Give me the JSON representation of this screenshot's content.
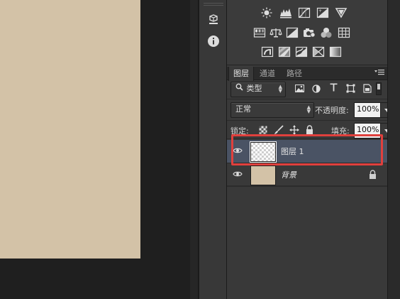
{
  "colors": {
    "canvas": "#d3c2a7",
    "selected_row": "#4a5364",
    "highlight_box": "#e0403d"
  },
  "tool_strip": {
    "items": [
      {
        "icon": "3d-object-icon"
      },
      {
        "icon": "info-icon"
      }
    ]
  },
  "adjustments": {
    "rows": [
      [
        "brightness-contrast-icon",
        "levels-icon",
        "curves-icon",
        "exposure-icon",
        "vibrance-icon"
      ],
      [
        "hue-saturation-icon",
        "color-balance-icon",
        "black-white-icon",
        "photo-filter-icon",
        "channel-mixer-icon",
        "color-lookup-icon"
      ],
      [
        "invert-icon",
        "posterize-icon",
        "threshold-icon",
        "selective-color-icon",
        "gradient-map-icon"
      ]
    ]
  },
  "layers_panel": {
    "tabs": [
      "图层",
      "通道",
      "路径"
    ],
    "active_tab": "图层",
    "filter": {
      "kind_label": "类型",
      "icons": [
        "pixel-filter-icon",
        "adjustment-filter-icon",
        "type-filter-icon",
        "shape-filter-icon",
        "smart-object-filter-icon"
      ]
    },
    "blend_mode": "正常",
    "opacity_label": "不透明度:",
    "opacity_value": "100%",
    "lock_label": "锁定:",
    "lock_icons": [
      "lock-transparent-icon",
      "lock-pixels-icon",
      "lock-position-icon",
      "lock-all-icon"
    ],
    "fill_label": "填充:",
    "fill_value": "100%",
    "layers": [
      {
        "name": "图层 1",
        "selected": true,
        "thumbnail": "transparent",
        "locked": false
      },
      {
        "name": "背景",
        "selected": false,
        "thumbnail": "#d3c2a7",
        "locked": true
      }
    ]
  }
}
